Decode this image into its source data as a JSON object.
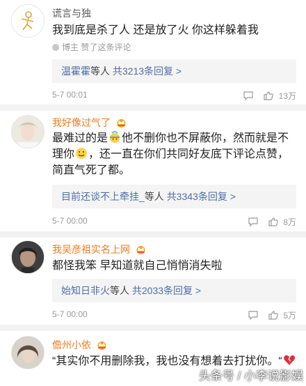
{
  "comments": [
    {
      "username": "谎言与独",
      "text": "我到底是杀了人 还是放了火 你这样躲着我",
      "liked_by": "博主 赞了这条评论",
      "reply_users": "温霍霍",
      "reply_middle": "等人",
      "reply_count": "共3213条回复 >",
      "time": "5-7 00:01",
      "likes": "13万"
    },
    {
      "username": "我好像过气了",
      "text_a": "最难过的是",
      "text_b": "他不删你也不屏蔽你，然而就是不理你",
      "text_c": "，还一直在你们共同好友底下评论点赞，简直气死了都。",
      "reply_users": "目前还谈不上牵挂_",
      "reply_middle": "等人",
      "reply_count": "共3343条回复 >",
      "time": "5-7 00:00",
      "likes": "8万"
    },
    {
      "username": "我吴彦祖实名上网",
      "text": "都怪我笨 早知道就自己悄悄消失啦",
      "reply_users": "始知日非火",
      "reply_middle": "等人",
      "reply_count": "共2033条回复 >",
      "time": "5-7 00:00",
      "likes": "5万"
    },
    {
      "username": "儋州小依",
      "text_a": "“其实你不用删除我，我也没有想着去打扰你。“"
    }
  ],
  "watermark": "头条号 / 小李说影娱",
  "colors": {
    "vip_username": "#ef7b22",
    "reply_link": "#4e6fa6",
    "meta_gray": "#999999",
    "divider": "#f2f2f2"
  }
}
